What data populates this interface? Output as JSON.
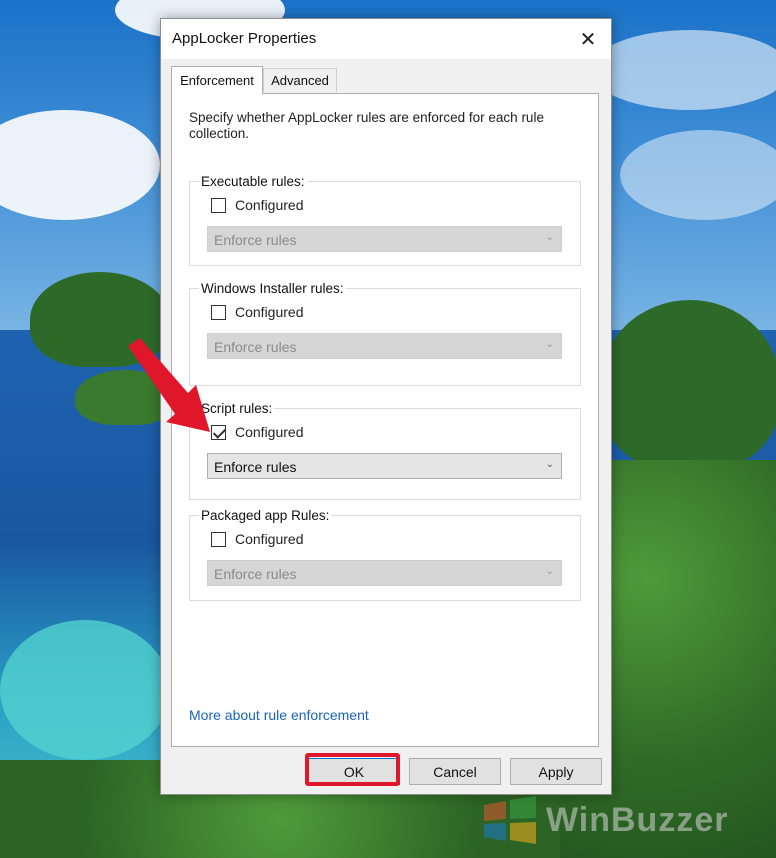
{
  "window": {
    "title": "AppLocker Properties",
    "close_glyph": "✕"
  },
  "tabs": [
    {
      "label": "Enforcement",
      "active": true
    },
    {
      "label": "Advanced",
      "active": false
    }
  ],
  "description": "Specify whether AppLocker rules are enforced for each rule collection.",
  "groups": [
    {
      "label": "Executable rules:",
      "checkbox_label": "Configured",
      "checked": false,
      "select_value": "Enforce rules",
      "enabled": false
    },
    {
      "label": "Windows Installer rules:",
      "checkbox_label": "Configured",
      "checked": false,
      "select_value": "Enforce rules",
      "enabled": false
    },
    {
      "label": "Script rules:",
      "checkbox_label": "Configured",
      "checked": true,
      "select_value": "Enforce rules",
      "enabled": true
    },
    {
      "label": "Packaged app Rules:",
      "checkbox_label": "Configured",
      "checked": false,
      "select_value": "Enforce rules",
      "enabled": false
    }
  ],
  "link": "More about rule enforcement",
  "buttons": {
    "ok": "OK",
    "cancel": "Cancel",
    "apply": "Apply"
  },
  "icons": {
    "select_arrow": "chevron-down-icon",
    "close": "close-icon"
  },
  "colors": {
    "highlight": "#e0162b",
    "link": "#1a64b8",
    "default_button_border": "#0078d7"
  },
  "watermark": "WinBuzzer"
}
